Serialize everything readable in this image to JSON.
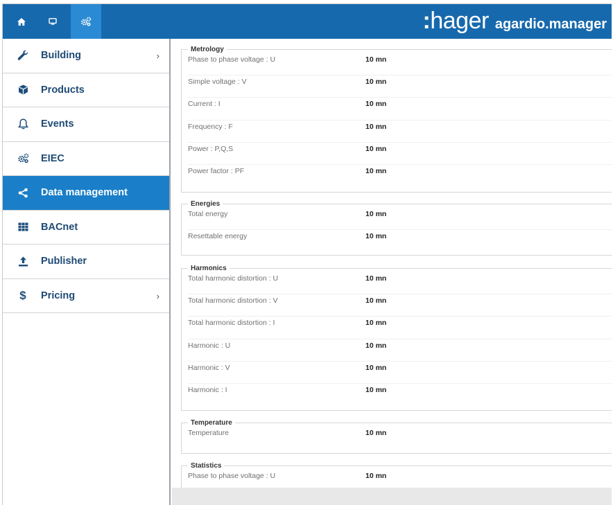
{
  "app": {
    "brand_logo_prefix": ":",
    "brand_logo": "hager",
    "brand_app": "agardio.manager",
    "accent": "#1769ad",
    "active_color": "#1a7fc8"
  },
  "top_buttons": [
    {
      "name": "home-icon"
    },
    {
      "name": "monitor-icon"
    },
    {
      "name": "settings-icon"
    }
  ],
  "sidebar": {
    "items": [
      {
        "label": "Building",
        "icon": "wrench-icon",
        "chevron": "›"
      },
      {
        "label": "Products",
        "icon": "cube-icon"
      },
      {
        "label": "Events",
        "icon": "bell-icon"
      },
      {
        "label": "EIEC",
        "icon": "gears-icon"
      },
      {
        "label": "Data management",
        "icon": "share-icon",
        "active": true
      },
      {
        "label": "BACnet",
        "icon": "grid-icon"
      },
      {
        "label": "Publisher",
        "icon": "upload-icon"
      },
      {
        "label": "Pricing",
        "icon": "dollar-icon",
        "glyph": "$",
        "chevron": "›"
      }
    ]
  },
  "groups": {
    "metrology": {
      "title": "Metrology",
      "rows": [
        {
          "name": "Phase to phase voltage : U",
          "value": "10 mn"
        },
        {
          "name": "Simple voltage : V",
          "value": "10 mn"
        },
        {
          "name": "Current : I",
          "value": "10 mn"
        },
        {
          "name": "Frequency : F",
          "value": "10 mn"
        },
        {
          "name": "Power : P,Q,S",
          "value": "10 mn"
        },
        {
          "name": "Power factor : PF",
          "value": "10 mn"
        }
      ]
    },
    "energies": {
      "title": "Energies",
      "rows": [
        {
          "name": "Total energy",
          "value": "10 mn"
        },
        {
          "name": "Resettable energy",
          "value": "10 mn"
        }
      ]
    },
    "harmonics": {
      "title": "Harmonics",
      "rows": [
        {
          "name": "Total harmonic distortion : U",
          "value": "10 mn"
        },
        {
          "name": "Total harmonic distortion : V",
          "value": "10 mn"
        },
        {
          "name": "Total harmonic distortion : I",
          "value": "10 mn"
        },
        {
          "name": "Harmonic : U",
          "value": "10 mn"
        },
        {
          "name": "Harmonic : V",
          "value": "10 mn"
        },
        {
          "name": "Harmonic : I",
          "value": "10 mn"
        }
      ]
    },
    "temperature": {
      "title": "Temperature",
      "rows": [
        {
          "name": "Temperature",
          "value": "10 mn"
        }
      ]
    },
    "statistics": {
      "title": "Statistics",
      "rows": [
        {
          "name": "Phase to phase voltage : U",
          "value": "10 mn"
        }
      ]
    }
  }
}
